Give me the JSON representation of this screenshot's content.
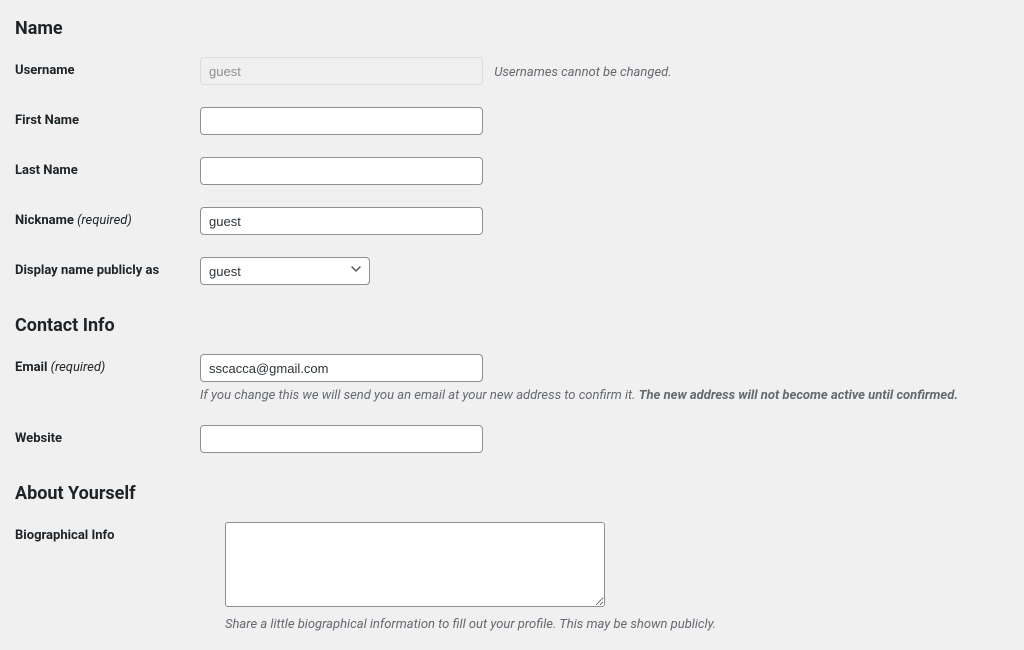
{
  "sections": {
    "name": "Name",
    "contact": "Contact Info",
    "about": "About Yourself"
  },
  "labels": {
    "username": "Username",
    "first_name": "First Name",
    "last_name": "Last Name",
    "nickname": "Nickname",
    "display_name": "Display name publicly as",
    "email": "Email",
    "website": "Website",
    "bio": "Biographical Info",
    "required": "(required)"
  },
  "values": {
    "username": "guest",
    "first_name": "",
    "last_name": "",
    "nickname": "guest",
    "display_name": "guest",
    "email": "sscacca@gmail.com",
    "website": "",
    "bio": ""
  },
  "descriptions": {
    "username_note": "Usernames cannot be changed.",
    "email_note_a": "If you change this we will send you an email at your new address to confirm it. ",
    "email_note_b": "The new address will not become active until confirmed.",
    "bio_note": "Share a little biographical information to fill out your profile. This may be shown publicly."
  }
}
